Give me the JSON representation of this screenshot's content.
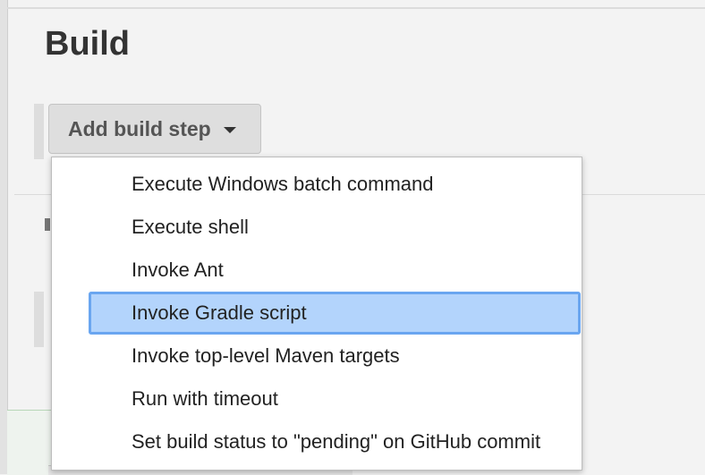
{
  "section": {
    "title": "Build"
  },
  "build_step": {
    "button_label": "Add build step",
    "menu_items": [
      {
        "label": "Execute Windows batch command",
        "highlighted": false
      },
      {
        "label": "Execute shell",
        "highlighted": false
      },
      {
        "label": "Invoke Ant",
        "highlighted": false
      },
      {
        "label": "Invoke Gradle script",
        "highlighted": true
      },
      {
        "label": "Invoke top-level Maven targets",
        "highlighted": false
      },
      {
        "label": "Run with timeout",
        "highlighted": false
      },
      {
        "label": "Set build status to \"pending\" on GitHub commit",
        "highlighted": false
      }
    ]
  },
  "colors": {
    "highlight_background": "#b3d4fc",
    "highlight_border": "#6aa6f0",
    "button_background": "#dedede",
    "page_background": "#f3f3f3"
  }
}
